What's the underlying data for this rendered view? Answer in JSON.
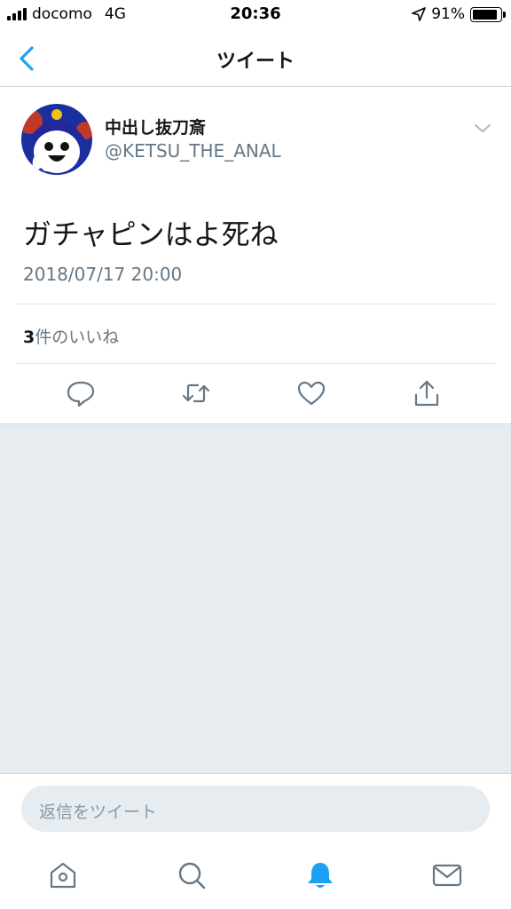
{
  "status_bar": {
    "carrier": "docomo",
    "network": "4G",
    "time": "20:36",
    "battery": "91%",
    "battery_level": 0.91
  },
  "nav": {
    "title": "ツイート",
    "back_icon": "chevron-left-icon"
  },
  "tweet": {
    "display_name": "中出し抜刀斎",
    "handle": "@KETSU_THE_ANAL",
    "text": "ガチャピンはよ死ね",
    "timestamp": "2018/07/17 20:00",
    "likes_count": "3",
    "likes_label": "件のいいね"
  },
  "actions": [
    "reply-icon",
    "retweet-icon",
    "like-icon",
    "share-icon"
  ],
  "reply": {
    "placeholder": "返信をツイート"
  },
  "tabs": [
    "home-icon",
    "search-icon",
    "notifications-icon",
    "messages-icon"
  ],
  "colors": {
    "accent": "#1da1f2",
    "secondary_text": "#657786",
    "background_gray": "#e6ecf0"
  }
}
